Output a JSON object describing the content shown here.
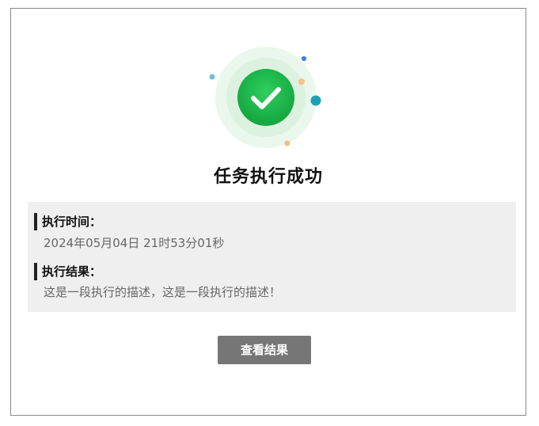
{
  "dialog": {
    "title": "任务执行成功",
    "icon": "success-check-icon",
    "colors": {
      "success_green": "#1cb04a",
      "halo": "#e4f5e6",
      "info_bg": "#efefef",
      "button_bg": "#767676",
      "border": "#8a8a8a"
    }
  },
  "info": {
    "time_label": "执行时间：",
    "time_value": "2024年05月04日 21时53分01秒",
    "result_label": "执行结果：",
    "result_value": "这是一段执行的描述，这是一段执行的描述！"
  },
  "actions": {
    "view_result_label": "查看结果"
  }
}
